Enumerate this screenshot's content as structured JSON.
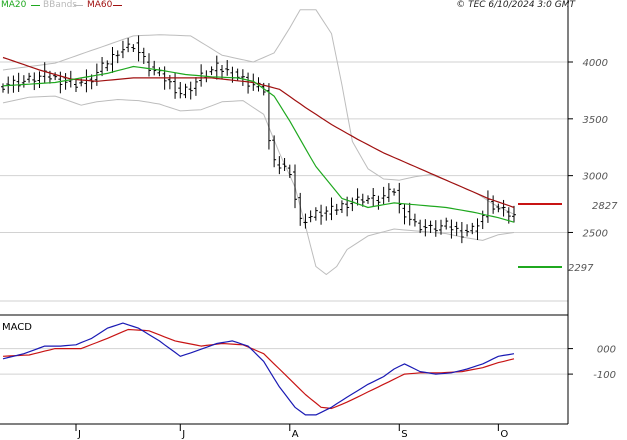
{
  "header": {
    "copyright": "© TEC 6/10/2024 3:0 GMT"
  },
  "legend": [
    {
      "label": "MA20",
      "color": "#1fa81f"
    },
    {
      "label": "BBands",
      "color": "#b9b9b9"
    },
    {
      "label": "MA60",
      "color": "#a01010"
    }
  ],
  "macd_panel": {
    "label": "MACD",
    "macd_color": "#1a1ab4",
    "signal_color": "#c81414"
  },
  "price_markers": {
    "ma60": {
      "value": "2827",
      "color": "#c81414"
    },
    "ma20": {
      "value": "2297",
      "color": "#1fa81f"
    }
  },
  "chart_data": [
    {
      "type": "line",
      "panel": "price",
      "title": "",
      "price_series_style": "ohlc bars",
      "y_ticks": [
        "4000",
        "3500",
        "3000",
        "2500"
      ],
      "y_tick_values": [
        4000,
        3500,
        3000,
        2500
      ],
      "ylim": [
        1800,
        4440
      ],
      "x_ticks": [
        "J",
        "J",
        "A",
        "S",
        "O"
      ],
      "x_tick_index": [
        14,
        34,
        55,
        76,
        95
      ],
      "n_bars": 99,
      "grid": true,
      "legend_position": "top-left",
      "series": [
        {
          "name": "price",
          "anchors": [
            [
              0,
              3800
            ],
            [
              4,
              3830
            ],
            [
              8,
              3880
            ],
            [
              12,
              3830
            ],
            [
              14,
              3810
            ],
            [
              17,
              3850
            ],
            [
              19,
              3950
            ],
            [
              22,
              4100
            ],
            [
              25,
              4150
            ],
            [
              28,
              3950
            ],
            [
              31,
              3850
            ],
            [
              34,
              3730
            ],
            [
              36,
              3780
            ],
            [
              38,
              3870
            ],
            [
              41,
              3950
            ],
            [
              44,
              3900
            ],
            [
              47,
              3820
            ],
            [
              50,
              3760
            ],
            [
              51,
              3300
            ],
            [
              52,
              3100
            ],
            [
              55,
              3050
            ],
            [
              56,
              2800
            ],
            [
              57,
              2600
            ],
            [
              60,
              2660
            ],
            [
              63,
              2690
            ],
            [
              66,
              2760
            ],
            [
              69,
              2800
            ],
            [
              72,
              2790
            ],
            [
              74,
              2840
            ],
            [
              75,
              2870
            ],
            [
              76,
              2730
            ],
            [
              79,
              2570
            ],
            [
              82,
              2530
            ],
            [
              85,
              2560
            ],
            [
              88,
              2500
            ],
            [
              90,
              2530
            ],
            [
              92,
              2650
            ],
            [
              93,
              2760
            ],
            [
              95,
              2700
            ],
            [
              97,
              2660
            ],
            [
              98,
              2640
            ]
          ]
        },
        {
          "name": "MA20",
          "anchors": [
            [
              0,
              3790
            ],
            [
              10,
              3820
            ],
            [
              20,
              3900
            ],
            [
              25,
              3960
            ],
            [
              30,
              3930
            ],
            [
              35,
              3890
            ],
            [
              40,
              3870
            ],
            [
              45,
              3860
            ],
            [
              48,
              3830
            ],
            [
              52,
              3700
            ],
            [
              55,
              3480
            ],
            [
              60,
              3080
            ],
            [
              65,
              2800
            ],
            [
              70,
              2720
            ],
            [
              75,
              2760
            ],
            [
              80,
              2740
            ],
            [
              85,
              2720
            ],
            [
              90,
              2680
            ],
            [
              95,
              2630
            ],
            [
              98,
              2590
            ]
          ]
        },
        {
          "name": "MA60",
          "anchors": [
            [
              0,
              4040
            ],
            [
              7,
              3930
            ],
            [
              13,
              3850
            ],
            [
              18,
              3830
            ],
            [
              25,
              3860
            ],
            [
              32,
              3860
            ],
            [
              40,
              3860
            ],
            [
              48,
              3820
            ],
            [
              53,
              3760
            ],
            [
              58,
              3600
            ],
            [
              63,
              3450
            ],
            [
              68,
              3320
            ],
            [
              73,
              3200
            ],
            [
              78,
              3100
            ],
            [
              83,
              3000
            ],
            [
              88,
              2900
            ],
            [
              93,
              2800
            ],
            [
              98,
              2720
            ]
          ]
        },
        {
          "name": "BB upper",
          "anchors": [
            [
              0,
              3930
            ],
            [
              10,
              3990
            ],
            [
              20,
              4150
            ],
            [
              25,
              4230
            ],
            [
              30,
              4240
            ],
            [
              36,
              4230
            ],
            [
              42,
              4060
            ],
            [
              48,
              4000
            ],
            [
              52,
              4080
            ],
            [
              55,
              4300
            ],
            [
              57,
              4460
            ],
            [
              60,
              4460
            ],
            [
              63,
              4250
            ],
            [
              65,
              3800
            ],
            [
              67,
              3300
            ],
            [
              70,
              3060
            ],
            [
              73,
              2970
            ],
            [
              76,
              2960
            ],
            [
              79,
              2990
            ],
            [
              82,
              3010
            ],
            [
              85,
              2960
            ],
            [
              88,
              2900
            ],
            [
              91,
              2840
            ],
            [
              94,
              2750
            ],
            [
              98,
              2660
            ]
          ]
        },
        {
          "name": "BB lower",
          "anchors": [
            [
              0,
              3640
            ],
            [
              5,
              3690
            ],
            [
              10,
              3700
            ],
            [
              15,
              3620
            ],
            [
              18,
              3650
            ],
            [
              22,
              3670
            ],
            [
              26,
              3660
            ],
            [
              30,
              3630
            ],
            [
              34,
              3570
            ],
            [
              38,
              3580
            ],
            [
              42,
              3650
            ],
            [
              46,
              3660
            ],
            [
              50,
              3540
            ],
            [
              53,
              3200
            ],
            [
              56,
              2900
            ],
            [
              58,
              2560
            ],
            [
              60,
              2200
            ],
            [
              62,
              2130
            ],
            [
              64,
              2200
            ],
            [
              66,
              2350
            ],
            [
              70,
              2470
            ],
            [
              75,
              2530
            ],
            [
              80,
              2510
            ],
            [
              85,
              2490
            ],
            [
              88,
              2460
            ],
            [
              92,
              2430
            ],
            [
              95,
              2480
            ],
            [
              98,
              2500
            ]
          ]
        }
      ]
    },
    {
      "type": "line",
      "panel": "macd",
      "title": "MACD",
      "y_ticks": [
        "000",
        "-100"
      ],
      "y_tick_values": [
        0,
        -100
      ],
      "ylim": [
        -280,
        120
      ],
      "series": [
        {
          "name": "MACD",
          "anchors": [
            [
              0,
              -40
            ],
            [
              4,
              -20
            ],
            [
              8,
              10
            ],
            [
              11,
              10
            ],
            [
              14,
              15
            ],
            [
              17,
              40
            ],
            [
              20,
              80
            ],
            [
              23,
              100
            ],
            [
              26,
              80
            ],
            [
              30,
              30
            ],
            [
              34,
              -30
            ],
            [
              37,
              -10
            ],
            [
              41,
              20
            ],
            [
              44,
              30
            ],
            [
              47,
              10
            ],
            [
              50,
              -50
            ],
            [
              53,
              -150
            ],
            [
              56,
              -230
            ],
            [
              58,
              -260
            ],
            [
              60,
              -260
            ],
            [
              63,
              -230
            ],
            [
              66,
              -190
            ],
            [
              70,
              -140
            ],
            [
              73,
              -110
            ],
            [
              75,
              -80
            ],
            [
              77,
              -60
            ],
            [
              80,
              -90
            ],
            [
              83,
              -100
            ],
            [
              86,
              -95
            ],
            [
              89,
              -80
            ],
            [
              92,
              -60
            ],
            [
              95,
              -30
            ],
            [
              98,
              -20
            ]
          ]
        },
        {
          "name": "Signal",
          "anchors": [
            [
              0,
              -30
            ],
            [
              5,
              -25
            ],
            [
              10,
              0
            ],
            [
              15,
              0
            ],
            [
              20,
              40
            ],
            [
              24,
              75
            ],
            [
              28,
              70
            ],
            [
              33,
              30
            ],
            [
              38,
              10
            ],
            [
              42,
              20
            ],
            [
              46,
              15
            ],
            [
              50,
              -20
            ],
            [
              54,
              -100
            ],
            [
              58,
              -180
            ],
            [
              61,
              -230
            ],
            [
              63,
              -235
            ],
            [
              66,
              -210
            ],
            [
              70,
              -170
            ],
            [
              74,
              -130
            ],
            [
              77,
              -100
            ],
            [
              80,
              -95
            ],
            [
              84,
              -95
            ],
            [
              88,
              -90
            ],
            [
              92,
              -75
            ],
            [
              95,
              -55
            ],
            [
              98,
              -40
            ]
          ]
        }
      ]
    }
  ]
}
